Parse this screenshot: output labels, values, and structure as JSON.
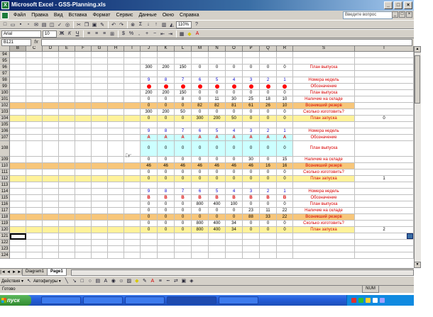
{
  "window": {
    "title": "Microsoft Excel - GSS-Planning.xls",
    "app_icon": "excel-icon",
    "buttons": [
      "_",
      "□",
      "×"
    ]
  },
  "menubar": {
    "items": [
      "Файл",
      "Правка",
      "Вид",
      "Вставка",
      "Формат",
      "Сервис",
      "Данные",
      "Окно",
      "Справка"
    ],
    "help_placeholder": "Введите вопрос",
    "mdi_buttons": [
      "_",
      "□",
      "×"
    ]
  },
  "toolbar1": {
    "zoom": "110%"
  },
  "toolbar2": {
    "font_name": "Arial",
    "font_size": "10"
  },
  "formulabar": {
    "namebox": "B121",
    "fx": "fx"
  },
  "columns": [
    "B",
    "C",
    "D",
    "E",
    "F",
    "G",
    "H",
    "I",
    "J",
    "K",
    "L",
    "M",
    "N",
    "O",
    "P",
    "Q",
    "R",
    "S",
    "T"
  ],
  "selected_column": "B",
  "rows": [
    {
      "num": "94",
      "cells": {}
    },
    {
      "num": "95",
      "cells": {}
    },
    {
      "num": "96",
      "cells": {
        "J": "300",
        "K": "200",
        "L": "150",
        "M": "0",
        "N": "0",
        "O": "0",
        "P": "0",
        "Q": "0",
        "R": "0"
      },
      "label": "План выпуска",
      "label_color": "#d80000"
    },
    {
      "num": "97",
      "cells": {}
    },
    {
      "num": "98",
      "cells": {
        "J": "9",
        "K": "8",
        "L": "7",
        "M": "6",
        "N": "5",
        "O": "4",
        "P": "3",
        "Q": "2",
        "R": "1"
      },
      "label": "Номера недель",
      "label_color": "#d80000",
      "nums_color": "#0000cc"
    },
    {
      "num": "99",
      "dots": true,
      "label": "Обозначение",
      "label_color": "#d80000"
    },
    {
      "num": "100",
      "cells": {
        "J": "200",
        "K": "200",
        "L": "150",
        "M": "0",
        "N": "0",
        "O": "0",
        "P": "0",
        "Q": "0",
        "R": "0"
      },
      "label": "План выпуска",
      "label_color": "#d80000"
    },
    {
      "num": "101",
      "cells": {
        "J": "0",
        "K": "0",
        "L": "8",
        "M": "0",
        "N": "11",
        "O": "30",
        "P": "25",
        "Q": "18",
        "R": "10"
      },
      "label": "Наличие на складе",
      "label_color": "#d80000"
    },
    {
      "num": "102",
      "band": "orange",
      "cells": {
        "J": "0",
        "K": "0",
        "L": "0",
        "M": "82",
        "N": "82",
        "O": "81",
        "P": "61",
        "Q": "26",
        "R": "10"
      },
      "label": "Возникший резерв",
      "label_color": "#d80000"
    },
    {
      "num": "103",
      "cells": {
        "J": "300",
        "K": "200",
        "L": "50",
        "M": "0",
        "N": "0",
        "O": "0",
        "P": "0",
        "Q": "0",
        "R": "0"
      },
      "label": "Сколько изготовить?",
      "label_color": "#d80000"
    },
    {
      "num": "104",
      "band": "yellow",
      "cells": {
        "J": "0",
        "K": "0",
        "L": "0",
        "M": "300",
        "N": "200",
        "O": "50",
        "P": "0",
        "Q": "0",
        "R": "0"
      },
      "label": "План запуска",
      "label_color": "#d80000",
      "t_value": "0"
    },
    {
      "num": "105",
      "cells": {}
    },
    {
      "num": "106",
      "cells": {
        "J": "9",
        "K": "8",
        "L": "7",
        "M": "6",
        "N": "5",
        "O": "4",
        "P": "3",
        "Q": "2",
        "R": "1"
      },
      "label": "Номера недель",
      "label_color": "#d80000",
      "nums_color": "#0000cc"
    },
    {
      "num": "107",
      "letters": "A",
      "letters_color": "#d80000",
      "cyan": true,
      "label": "Обозначение",
      "label_color": "#d80000"
    },
    {
      "num": "108",
      "tall": true,
      "cyan": true,
      "cells": {
        "J": "0",
        "K": "0",
        "L": "0",
        "M": "0",
        "N": "0",
        "O": "0",
        "P": "0",
        "Q": "0",
        "R": "0"
      },
      "label": "План выпуска",
      "label_color": "#d80000"
    },
    {
      "num": "109",
      "cells": {
        "J": "0",
        "K": "0",
        "L": "0",
        "M": "0",
        "N": "0",
        "O": "0",
        "P": "30",
        "Q": "0",
        "R": "15"
      },
      "label": "Наличие на складе",
      "label_color": "#d80000"
    },
    {
      "num": "110",
      "band": "orange",
      "cells": {
        "J": "46",
        "K": "46",
        "L": "46",
        "M": "46",
        "N": "46",
        "O": "46",
        "P": "46",
        "Q": "16",
        "R": "16"
      },
      "label": "Возникший резерв",
      "label_color": "#d80000"
    },
    {
      "num": "111",
      "cells": {
        "J": "0",
        "K": "0",
        "L": "0",
        "M": "0",
        "N": "0",
        "O": "0",
        "P": "0",
        "Q": "0",
        "R": "0"
      },
      "label": "Сколько изготовить?",
      "label_color": "#d80000"
    },
    {
      "num": "112",
      "band": "yellow",
      "cells": {
        "J": "0",
        "K": "0",
        "L": "0",
        "M": "0",
        "N": "0",
        "O": "0",
        "P": "0",
        "Q": "0",
        "R": "0"
      },
      "label": "План запуска",
      "label_color": "#d80000",
      "t_value": "1"
    },
    {
      "num": "113",
      "cells": {}
    },
    {
      "num": "114",
      "cells": {
        "J": "9",
        "K": "8",
        "L": "7",
        "M": "6",
        "N": "5",
        "O": "4",
        "P": "3",
        "Q": "2",
        "R": "1"
      },
      "label": "Номера недель",
      "label_color": "#d80000",
      "nums_color": "#0000cc"
    },
    {
      "num": "115",
      "letters": "B",
      "letters_color": "#d80000",
      "label": "Обозначение",
      "label_color": "#d80000"
    },
    {
      "num": "116",
      "cells": {
        "J": "0",
        "K": "0",
        "L": "0",
        "M": "800",
        "N": "400",
        "O": "100",
        "P": "0",
        "Q": "0",
        "R": "0"
      },
      "label": "План выпуска",
      "label_color": "#d80000"
    },
    {
      "num": "117",
      "cells": {
        "J": "0",
        "K": "0",
        "L": "0",
        "M": "0",
        "N": "0",
        "O": "0",
        "P": "23",
        "Q": "11",
        "R": "22"
      },
      "label": "Наличие на складе",
      "label_color": "#d80000"
    },
    {
      "num": "118",
      "band": "orange",
      "cells": {
        "J": "0",
        "K": "0",
        "L": "0",
        "M": "0",
        "N": "0",
        "O": "0",
        "P": "88",
        "Q": "33",
        "R": "22"
      },
      "label": "Возникший резерв",
      "label_color": "#d80000"
    },
    {
      "num": "119",
      "cells": {
        "J": "0",
        "K": "0",
        "L": "0",
        "M": "800",
        "N": "400",
        "O": "34",
        "P": "0",
        "Q": "0",
        "R": "0"
      },
      "label": "Сколько изготовить?",
      "label_color": "#d80000"
    },
    {
      "num": "120",
      "band": "yellow",
      "cells": {
        "J": "0",
        "K": "0",
        "L": "0",
        "M": "800",
        "N": "400",
        "O": "34",
        "P": "0",
        "Q": "0",
        "R": "0"
      },
      "label": "План запуска",
      "label_color": "#d80000",
      "t_value": "2"
    },
    {
      "num": "121",
      "cells": {},
      "active": true
    },
    {
      "num": "122",
      "cells": {}
    },
    {
      "num": "123",
      "cells": {}
    },
    {
      "num": "124",
      "cells": {}
    }
  ],
  "colors": {
    "orange_band": "#f7c67a",
    "yellow_band": "#fff29a",
    "cyan_block": "#ccffff",
    "dot": "#ff0000"
  },
  "sheets": {
    "nav": [
      "|◄",
      "◄",
      "►",
      "►|"
    ],
    "tabs": [
      "Diagram1",
      "Page1"
    ],
    "active": "Page1"
  },
  "drawbar": {
    "actions": "Действия ▾",
    "autoshapes": "Автофигуры ▾"
  },
  "status": {
    "ready": "Готово",
    "num": "NUM"
  },
  "taskbar": {
    "start": "пуск",
    "buttons": [
      "",
      "",
      "",
      "",
      ""
    ],
    "clock": ""
  }
}
